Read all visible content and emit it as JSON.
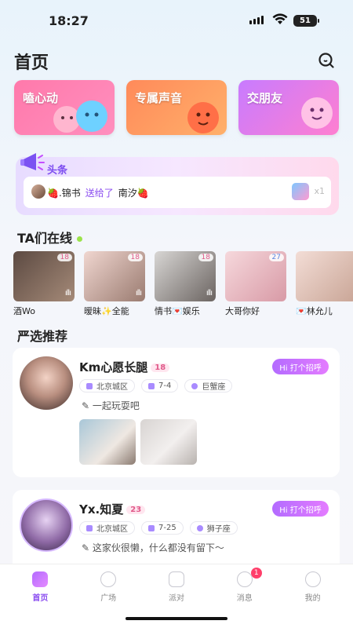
{
  "status": {
    "time": "18:27",
    "battery": "51"
  },
  "header": {
    "title": "首页"
  },
  "cards": [
    {
      "label": "嗑心动",
      "color": "#ff85b4"
    },
    {
      "label": "专属声音",
      "color": "#ff9a5f"
    },
    {
      "label": "交朋友",
      "color": "#c77fff"
    }
  ],
  "news": {
    "title": "头条",
    "sender": "🍓.锦书",
    "action": "送给了",
    "receiver": "南汐🍓",
    "gift_count": "x1"
  },
  "online": {
    "title": "TA们在线",
    "users": [
      {
        "name": "酒Wo",
        "age": "18"
      },
      {
        "name": "暧昧✨全能",
        "age": "18"
      },
      {
        "name": "情书💌娱乐",
        "age": "18"
      },
      {
        "name": "大哥你好",
        "age": "27"
      },
      {
        "name": "💌林允儿",
        "age": ""
      }
    ]
  },
  "recommend": {
    "title": "严选推荐",
    "items": [
      {
        "name": "Km心愿长腿",
        "age": "18",
        "hi": "Hi 打个招呼",
        "location": "北京城区",
        "height": "7-4",
        "zodiac": "巨蟹座",
        "desc": "一起玩耍吧"
      },
      {
        "name": "Yx.知夏",
        "age": "23",
        "hi": "Hi 打个招呼",
        "location": "北京城区",
        "height": "7-25",
        "zodiac": "狮子座",
        "desc": "这家伙很懒，什么都没有留下～"
      }
    ]
  },
  "nav": [
    {
      "label": "首页"
    },
    {
      "label": "广场"
    },
    {
      "label": "派对"
    },
    {
      "label": "消息",
      "badge": "1"
    },
    {
      "label": "我的"
    }
  ],
  "colors": {
    "accent": "#8b4df0",
    "pink": "#ff7fb0",
    "badge": "#ff3e6a"
  }
}
